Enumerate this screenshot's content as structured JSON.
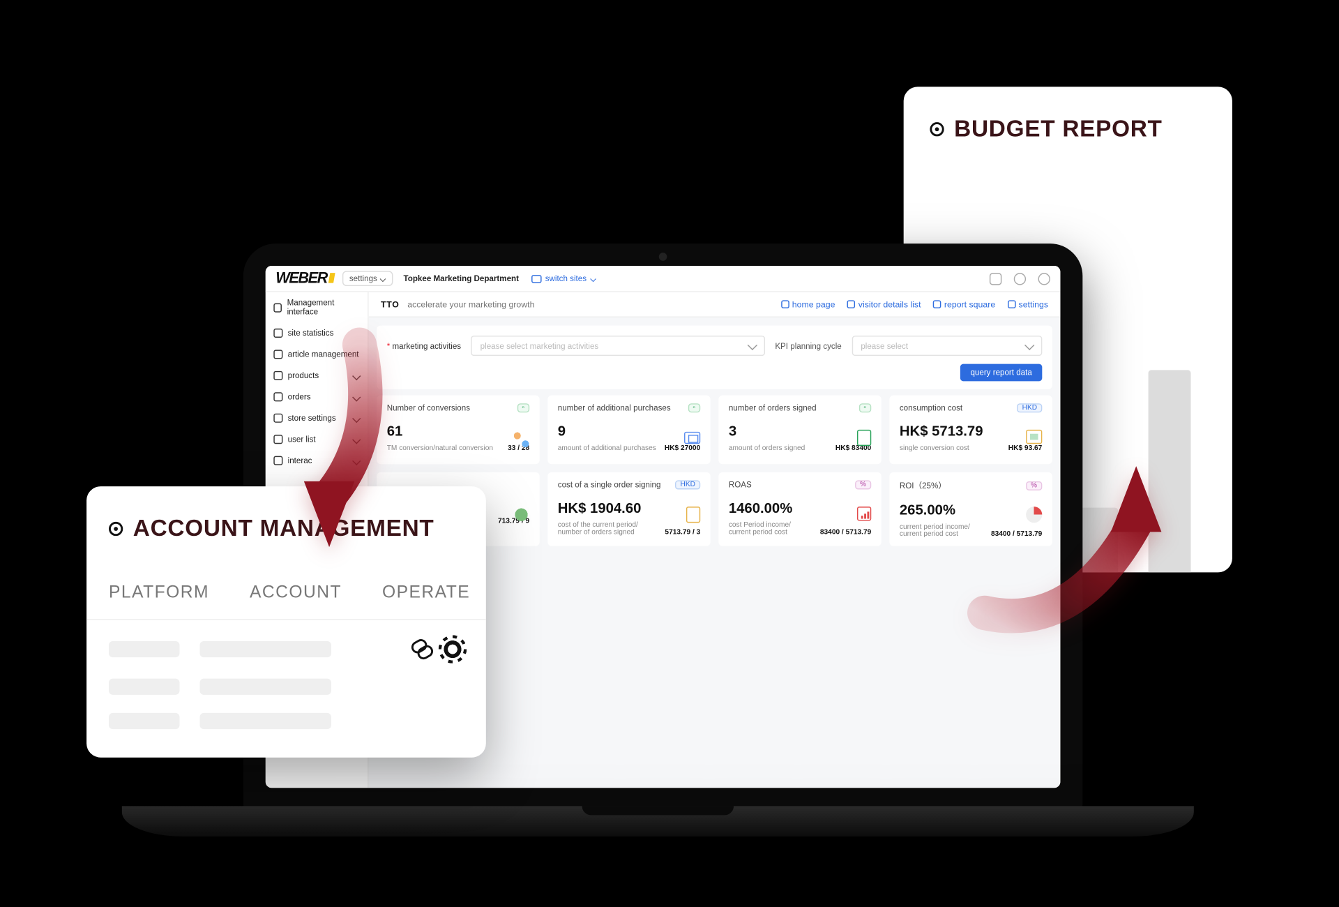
{
  "topbar": {
    "logo": "WEBER",
    "settings_label": "settings",
    "org": "Topkee Marketing Department",
    "switch_sites": "switch sites"
  },
  "sidebar": {
    "items": [
      {
        "label": "Management interface",
        "expandable": false
      },
      {
        "label": "site statistics",
        "expandable": false
      },
      {
        "label": "article management",
        "expandable": false
      },
      {
        "label": "products",
        "expandable": true
      },
      {
        "label": "orders",
        "expandable": true
      },
      {
        "label": "store settings",
        "expandable": true
      },
      {
        "label": "user list",
        "expandable": true
      },
      {
        "label": "interac",
        "expandable": true
      }
    ]
  },
  "subheader": {
    "tto": "TTO",
    "tagline": "accelerate your marketing growth",
    "links": {
      "home": "home page",
      "visitors": "visitor details list",
      "reports": "report square",
      "settings": "settings"
    }
  },
  "filters": {
    "marketing_label": "marketing activities",
    "marketing_placeholder": "please select marketing activities",
    "kpi_label": "KPI planning cycle",
    "kpi_placeholder": "please select",
    "query_btn": "query report data"
  },
  "cards": [
    {
      "title": "Number of conversions",
      "value": "61",
      "subLabel": "TM conversion/natural conversion",
      "subValue": "33 / 28",
      "tag": "count"
    },
    {
      "title": "number of additional purchases",
      "value": "9",
      "subLabel": "amount of additional purchases",
      "subValue": "HK$ 27000",
      "tag": "count"
    },
    {
      "title": "number of orders signed",
      "value": "3",
      "subLabel": "amount of orders signed",
      "subValue": "HK$ 83400",
      "tag": "count"
    },
    {
      "title": "consumption cost",
      "value": "HK$ 5713.79",
      "subLabel": "single conversion cost",
      "subValue": "HK$ 93.67",
      "tag": "HKD"
    },
    {
      "title": "",
      "value": "",
      "subLabel": "",
      "subValue": "713.79 / 9",
      "tag": "HKD"
    },
    {
      "title": "cost of a single order signing",
      "value": "HK$ 1904.60",
      "subLabel": "cost of the current period/\nnumber of orders signed",
      "subValue": "5713.79 / 3",
      "tag": "HKD"
    },
    {
      "title": "ROAS",
      "value": "1460.00%",
      "subLabel": "cost Period income/\ncurrent period cost",
      "subValue": "83400 / 5713.79",
      "tag": "%"
    },
    {
      "title": "ROI（25%）",
      "value": "265.00%",
      "subLabel": "current period income/\ncurrent period cost",
      "subValue": "83400 / 5713.79",
      "tag": "%"
    }
  ],
  "account_card": {
    "title": "ACCOUNT MANAGEMENT",
    "headers": {
      "platform": "PLATFORM",
      "account": "ACCOUNT",
      "operate": "OPERATE"
    }
  },
  "budget_card": {
    "title": "BUDGET REPORT"
  }
}
